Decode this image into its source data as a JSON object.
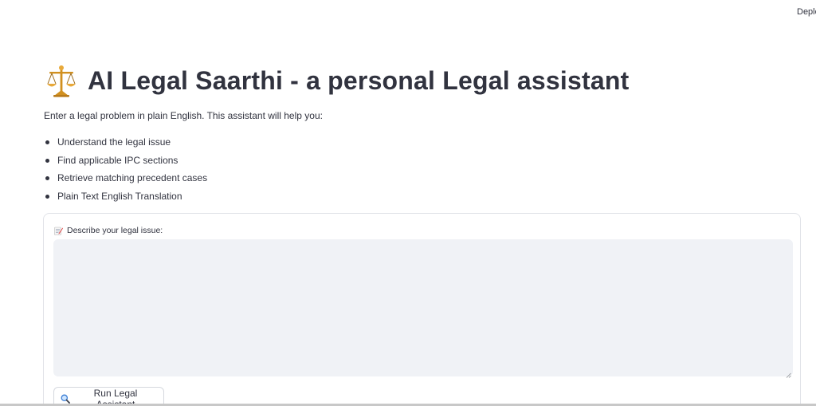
{
  "header": {
    "deploy_label": "Deplo"
  },
  "main": {
    "title_icon": "balance-scale-icon",
    "title": "AI Legal Saarthi - a personal Legal assistant",
    "intro": "Enter a legal problem in plain English. This assistant will help you:",
    "features": [
      "Understand the legal issue",
      "Find applicable IPC sections",
      "Retrieve matching precedent cases",
      "Plain Text English Translation"
    ]
  },
  "form": {
    "label_icon": "memo-icon",
    "label": "Describe your legal issue:",
    "issue_value": "",
    "issue_placeholder": "",
    "submit_icon": "magnifier-icon",
    "submit_label": "Run Legal Assistant"
  },
  "colors": {
    "text": "#31333f",
    "input_background": "#f0f2f6",
    "border": "#e1e3e8"
  }
}
